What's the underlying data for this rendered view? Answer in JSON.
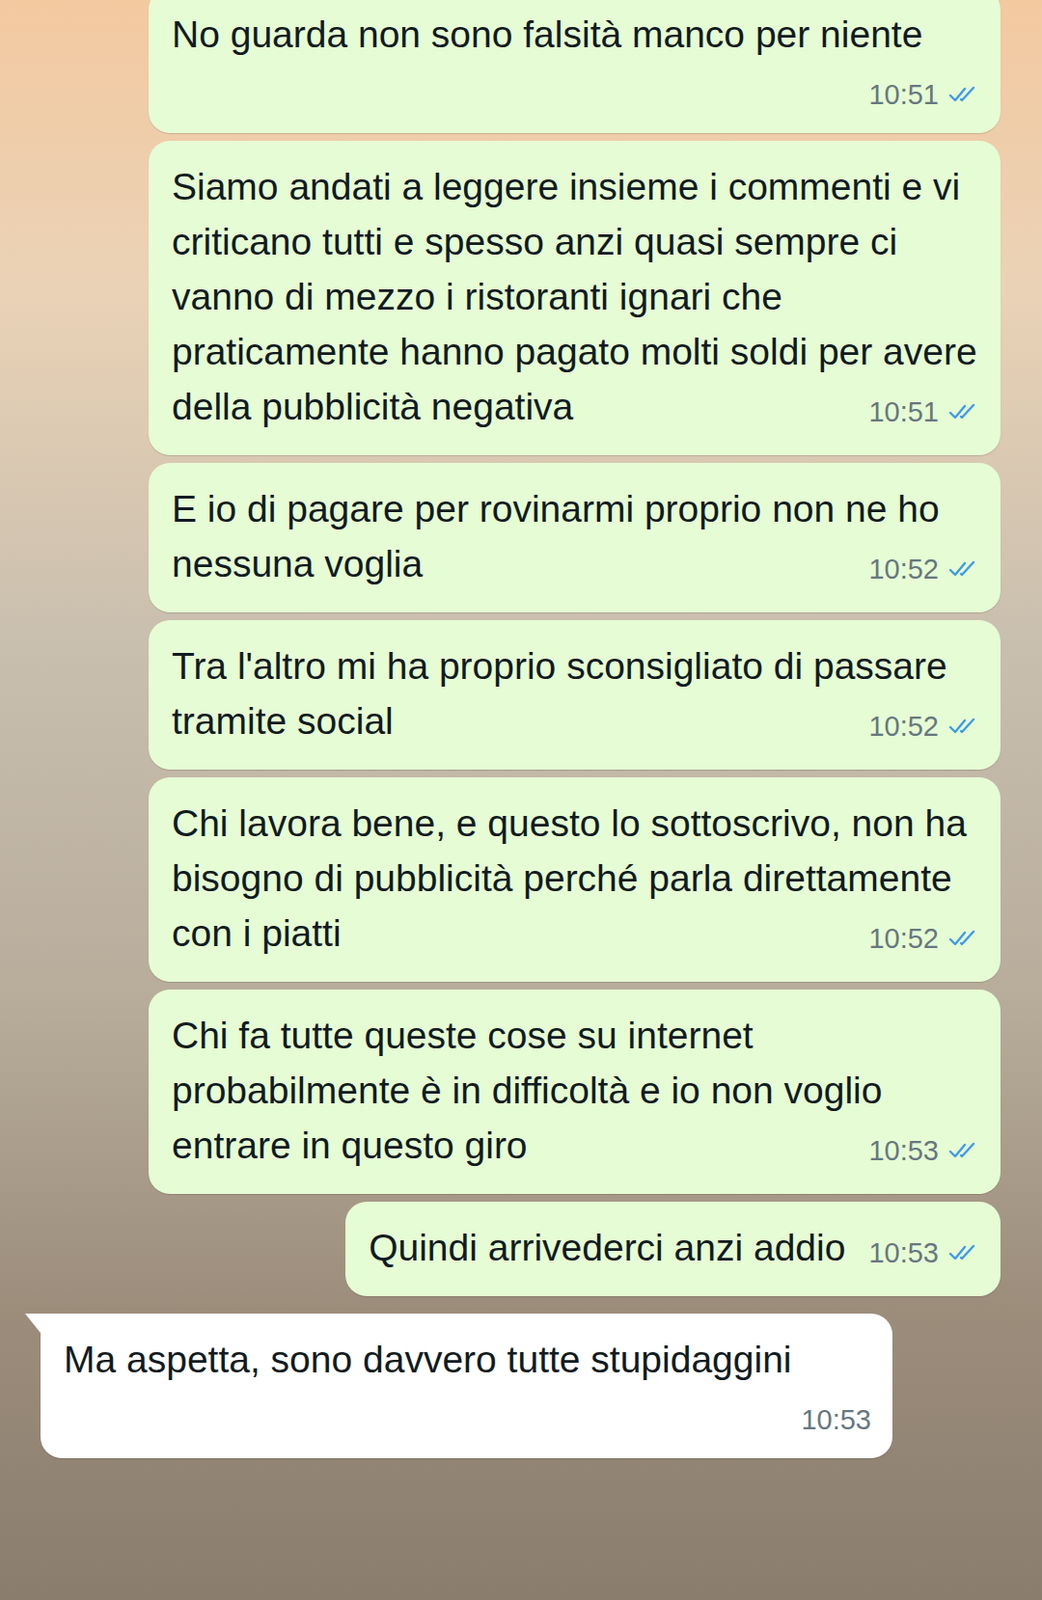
{
  "messages": [
    {
      "kind": "outgoing",
      "text": "No guarda non sono falsità manco per niente",
      "time": "10:51",
      "read": true
    },
    {
      "kind": "outgoing",
      "text": "Siamo andati a leggere insieme i commenti e vi criticano tutti e spesso anzi quasi sempre ci vanno di mezzo i ristoranti ignari che praticamente hanno pagato molti soldi per avere della pubblicità negativa",
      "time": "10:51",
      "read": true
    },
    {
      "kind": "outgoing",
      "text": "E io di pagare per rovinarmi proprio non ne ho nessuna voglia",
      "time": "10:52",
      "read": true
    },
    {
      "kind": "outgoing",
      "text": "Tra l'altro mi ha proprio sconsigliato di passare tramite social",
      "time": "10:52",
      "read": true
    },
    {
      "kind": "outgoing",
      "text": "Chi lavora bene, e questo lo sottoscrivo, non ha bisogno di pubblicità perché parla direttamente con i piatti",
      "time": "10:52",
      "read": true
    },
    {
      "kind": "outgoing",
      "text": "Chi fa tutte queste cose su internet probabilmente è in difficoltà e io non voglio entrare in questo giro",
      "time": "10:53",
      "read": true
    },
    {
      "kind": "outgoing",
      "text": "Quindi arrivederci anzi addio",
      "time": "10:53",
      "read": true
    },
    {
      "kind": "incoming",
      "text": "Ma aspetta, sono davvero tutte stupidaggini",
      "time": "10:53",
      "read": false
    }
  ]
}
